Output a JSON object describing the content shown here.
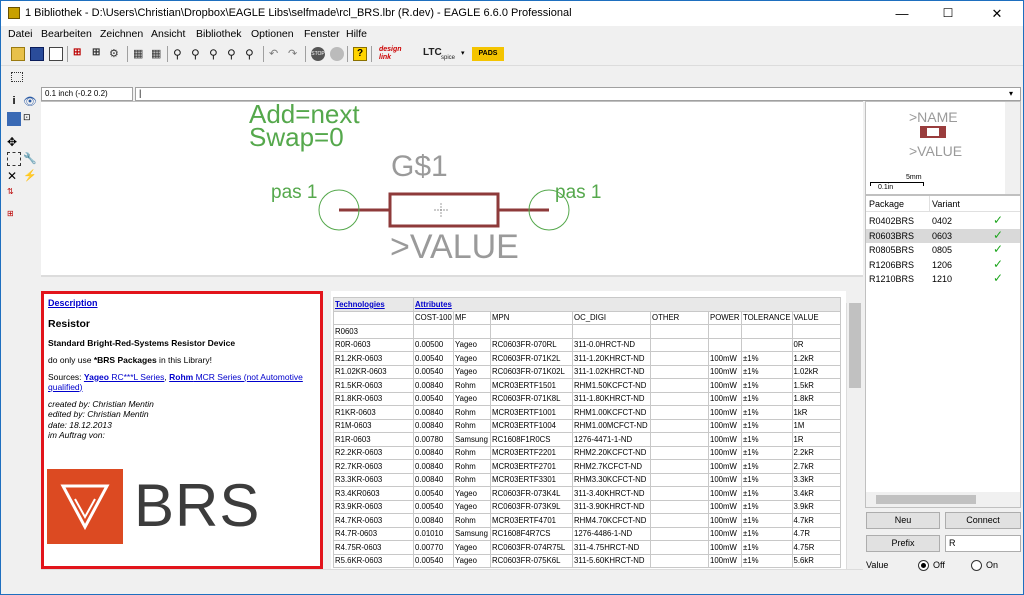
{
  "window": {
    "title": "1 Bibliothek - D:\\Users\\Christian\\Dropbox\\EAGLE Libs\\selfmade\\rcl_BRS.lbr (R.dev) - EAGLE 6.6.0 Professional",
    "minimize": "—",
    "maximize": "☐",
    "close": "✕"
  },
  "menu": [
    "Datei",
    "Bearbeiten",
    "Zeichnen",
    "Ansicht",
    "Bibliothek",
    "Optionen",
    "Fenster",
    "Hilfe"
  ],
  "toolbar": {
    "design_link": "design link",
    "ltc_label": "LTC",
    "ltc_sub": "spice",
    "pads_label": "PADS",
    "stop_label": "STOP"
  },
  "command": {
    "coord": "0.1 inch (-0.2 0.2)",
    "input": "|"
  },
  "canvas": {
    "add_text": "Add=next",
    "swap_text": "Swap=0",
    "name_text": "G$1",
    "value_text": ">VALUE",
    "pin_left": "pas 1",
    "pin_right": "pas 1"
  },
  "description": {
    "link": "Description",
    "title": "Resistor",
    "subtitle": "Standard Bright-Red-Systems Resistor Device",
    "note_pre": "do only use ",
    "note_bold": "*BRS Packages",
    "note_post": " in this Library!",
    "sources_pre": "Sources: ",
    "yageo_bold": "Yageo",
    "yageo_rest": " RC***L Series",
    "sep": ", ",
    "rohm_bold": "Rohm",
    "rohm_rest": " MCR Series (not Automotive qualified)",
    "created": "created by: Christian Mentin",
    "edited": "edited by: Christian Mentin",
    "date": "date: 18.12.2013",
    "auftrag": "im Auftrag von:",
    "logo_text": "BRS"
  },
  "tech_table": {
    "header1": [
      "Technologies",
      "Attributes"
    ],
    "header2": [
      "",
      "COST-100",
      "MF",
      "MPN",
      "OC_DIGI",
      "OTHER",
      "POWER",
      "TOLERANCE",
      "VALUE"
    ],
    "group": "R0603",
    "rows": [
      [
        "R0R-0603",
        "0.00500",
        "Yageo",
        "RC0603FR-070RL",
        "311-0.0HRCT-ND",
        "",
        "",
        "",
        "0R"
      ],
      [
        "R1.2KR-0603",
        "0.00540",
        "Yageo",
        "RC0603FR-071K2L",
        "311-1.20KHRCT-ND",
        "",
        "100mW",
        "±1%",
        "1.2kR"
      ],
      [
        "R1.02KR-0603",
        "0.00540",
        "Yageo",
        "RC0603FR-071K02L",
        "311-1.02KHRCT-ND",
        "",
        "100mW",
        "±1%",
        "1.02kR"
      ],
      [
        "R1.5KR-0603",
        "0.00840",
        "Rohm",
        "MCR03ERTF1501",
        "RHM1.50KCFCT-ND",
        "",
        "100mW",
        "±1%",
        "1.5kR"
      ],
      [
        "R1.8KR-0603",
        "0.00540",
        "Yageo",
        "RC0603FR-071K8L",
        "311-1.80KHRCT-ND",
        "",
        "100mW",
        "±1%",
        "1.8kR"
      ],
      [
        "R1KR-0603",
        "0.00840",
        "Rohm",
        "MCR03ERTF1001",
        "RHM1.00KCFCT-ND",
        "",
        "100mW",
        "±1%",
        "1kR"
      ],
      [
        "R1M-0603",
        "0.00840",
        "Rohm",
        "MCR03ERTF1004",
        "RHM1.00MCFCT-ND",
        "",
        "100mW",
        "±1%",
        "1M"
      ],
      [
        "R1R-0603",
        "0.00780",
        "Samsung",
        "RC1608F1R0CS",
        "1276-4471-1-ND",
        "",
        "100mW",
        "±1%",
        "1R"
      ],
      [
        "R2.2KR-0603",
        "0.00840",
        "Rohm",
        "MCR03ERTF2201",
        "RHM2.20KCFCT-ND",
        "",
        "100mW",
        "±1%",
        "2.2kR"
      ],
      [
        "R2.7KR-0603",
        "0.00840",
        "Rohm",
        "MCR03ERTF2701",
        "RHM2.7KCFCT-ND",
        "",
        "100mW",
        "±1%",
        "2.7kR"
      ],
      [
        "R3.3KR-0603",
        "0.00840",
        "Rohm",
        "MCR03ERTF3301",
        "RHM3.30KCFCT-ND",
        "",
        "100mW",
        "±1%",
        "3.3kR"
      ],
      [
        "R3.4KR0603",
        "0.00540",
        "Yageo",
        "RC0603FR-073K4L",
        "311-3.40KHRCT-ND",
        "",
        "100mW",
        "±1%",
        "3.4kR"
      ],
      [
        "R3.9KR-0603",
        "0.00540",
        "Yageo",
        "RC0603FR-073K9L",
        "311-3.90KHRCT-ND",
        "",
        "100mW",
        "±1%",
        "3.9kR"
      ],
      [
        "R4.7KR-0603",
        "0.00840",
        "Rohm",
        "MCR03ERTF4701",
        "RHM4.70KCFCT-ND",
        "",
        "100mW",
        "±1%",
        "4.7kR"
      ],
      [
        "R4.7R-0603",
        "0.01010",
        "Samsung",
        "RC1608F4R7CS",
        "1276-4486-1-ND",
        "",
        "100mW",
        "±1%",
        "4.7R"
      ],
      [
        "R4.75R-0603",
        "0.00770",
        "Yageo",
        "RC0603FR-074R75L",
        "311-4.75HRCT-ND",
        "",
        "100mW",
        "±1%",
        "4.75R"
      ],
      [
        "R5.6KR-0603",
        "0.00540",
        "Yageo",
        "RC0603FR-075K6L",
        "311-5.60KHRCT-ND",
        "",
        "100mW",
        "±1%",
        "5.6kR"
      ]
    ]
  },
  "preview": {
    "name": ">NAME",
    "value": ">VALUE",
    "scale_label": "5mm",
    "scale_sub": "0.1in"
  },
  "packages": {
    "col_package": "Package",
    "col_variant": "Variant",
    "rows": [
      {
        "package": "R0402BRS",
        "variant": "0402",
        "check": "✓"
      },
      {
        "package": "R0603BRS",
        "variant": "0603",
        "check": "✓"
      },
      {
        "package": "R0805BRS",
        "variant": "0805",
        "check": "✓"
      },
      {
        "package": "R1206BRS",
        "variant": "1206",
        "check": "✓"
      },
      {
        "package": "R1210BRS",
        "variant": "1210",
        "check": "✓"
      }
    ]
  },
  "buttons": {
    "neu": "Neu",
    "connect": "Connect",
    "prefix": "Prefix",
    "prefix_value": "R",
    "value_label": "Value",
    "off": "Off",
    "on": "On"
  },
  "colors": {
    "canvas_text": "#55a84c",
    "gray_text": "#9a9a9a",
    "resistor": "#8e3a3a",
    "highlight_border": "#e2141b",
    "logo_red": "#dc4a22",
    "check": "#1ea61e"
  }
}
